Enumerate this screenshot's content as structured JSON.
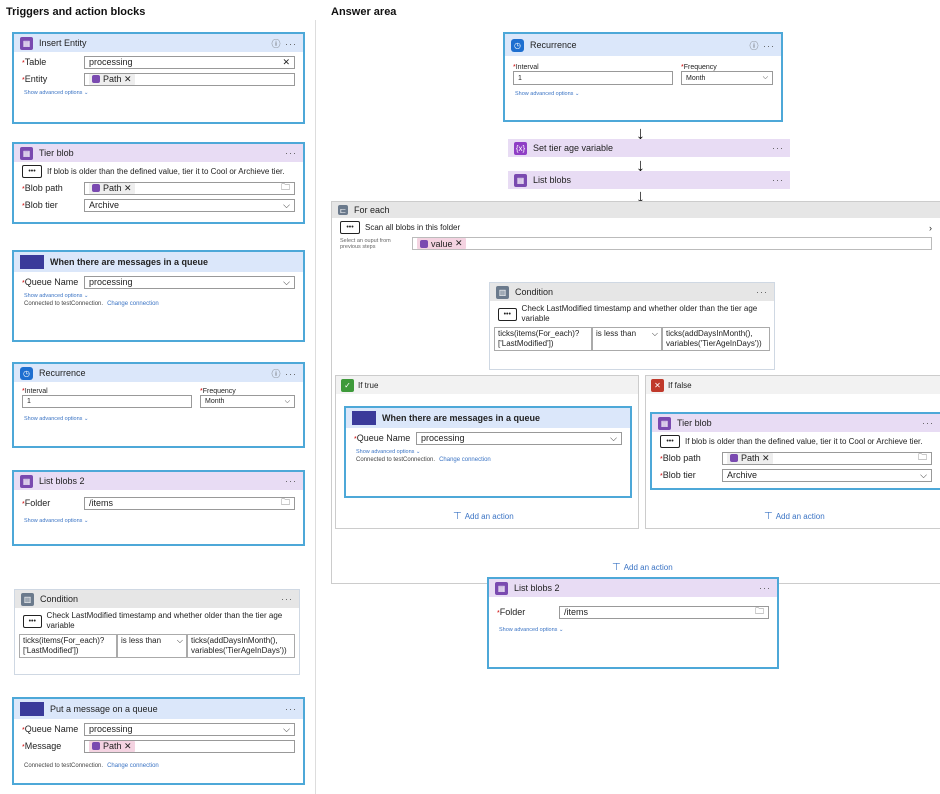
{
  "left_title": "Triggers and action blocks",
  "right_title": "Answer area",
  "insert_entity": {
    "title": "Insert Entity",
    "table_label": "Table",
    "table_value": "processing",
    "entity_label": "Entity",
    "entity_token": "Path",
    "advanced": "Show advanced options"
  },
  "tier_blob": {
    "title": "Tier blob",
    "desc": "If blob is older than the defined value, tier it to Cool or Archieve tier.",
    "path_label": "Blob path",
    "path_token": "Path",
    "tier_label": "Blob tier",
    "tier_value": "Archive"
  },
  "queue_trigger": {
    "title": "When there are messages in a queue",
    "queue_label": "Queue Name",
    "queue_value": "processing",
    "advanced": "Show advanced options",
    "connected": "Connected to testConnection.",
    "change": "Change connection"
  },
  "recurrence": {
    "title": "Recurrence",
    "interval_label": "Interval",
    "interval_value": "1",
    "frequency_label": "Frequency",
    "frequency_value": "Month",
    "advanced": "Show advanced options"
  },
  "list_blobs2": {
    "title": "List blobs 2",
    "folder_label": "Folder",
    "folder_value": "/items",
    "advanced": "Show advanced options"
  },
  "condition": {
    "title": "Condition",
    "desc": "Check LastModified timestamp and whether older than the tier age variable",
    "left": "ticks(items(For_each)?['LastModified'])",
    "op": "is less than",
    "right": "ticks(addDaysInMonth(), variables('TierAgeInDays'))"
  },
  "put_message": {
    "title": "Put a message on a queue",
    "queue_label": "Queue Name",
    "queue_value": "processing",
    "message_label": "Message",
    "message_token": "Path",
    "connected": "Connected to testConnection.",
    "change": "Change connection"
  },
  "answer": {
    "set_var": "Set tier age variable",
    "list_blobs": "List blobs",
    "for_each": "For each",
    "scan": "Scan all blobs in this folder",
    "select_output": "Select an ouput from previous steps",
    "value_token": "value",
    "if_true": "If true",
    "if_false": "If false",
    "add_action": "Add an action"
  }
}
